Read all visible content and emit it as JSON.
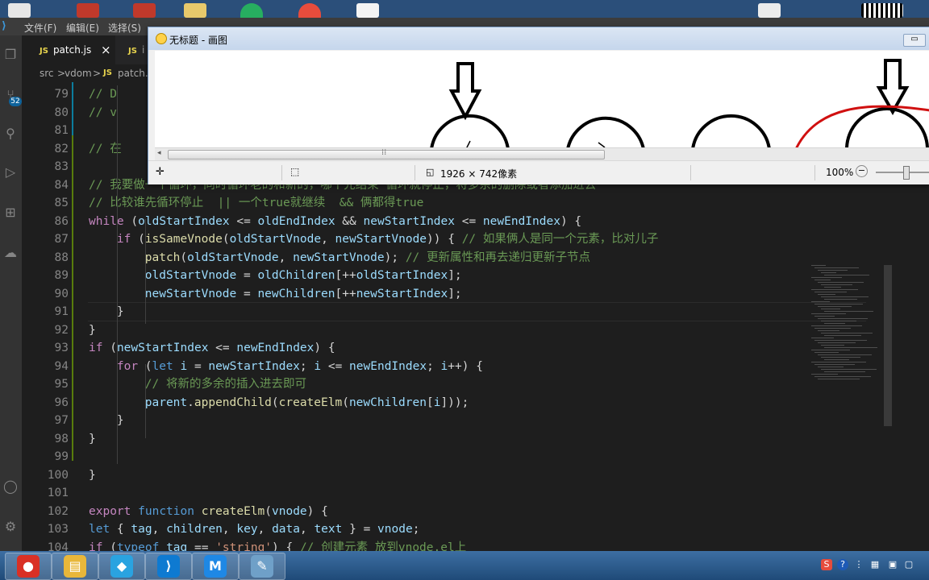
{
  "vscode": {
    "menu": [
      "文件(F)",
      "编辑(E)",
      "选择(S)"
    ],
    "badge": "52",
    "tabs": [
      {
        "icon": "JS",
        "label": "patch.js",
        "close": "×"
      },
      {
        "icon": "JS",
        "label": "i"
      }
    ],
    "breadcrumb": [
      "src",
      "vdom",
      "patch.js"
    ],
    "breadcrumb_sep": ">",
    "breadcrumb_icon": "JS"
  },
  "paint": {
    "title": "无标题 - 画图",
    "minimize": "▭",
    "size": "1926 × 742像素",
    "zoom": "100%"
  },
  "code": [
    {
      "n": "79",
      "t": [
        [
          "cm",
          "// D"
        ]
      ],
      "i": 1
    },
    {
      "n": "80",
      "t": [
        [
          "cm",
          "// v"
        ]
      ],
      "i": 1
    },
    {
      "n": "81",
      "t": [],
      "i": 0
    },
    {
      "n": "82",
      "t": [
        [
          "cm",
          "// 在"
        ]
      ],
      "i": 1
    },
    {
      "n": "83",
      "t": [],
      "i": 0
    },
    {
      "n": "84",
      "t": [
        [
          "cm",
          "// 我要做一个循环，同时循环老的和新的，哪个先结束 循环就停止，将多余的删除或者添加进去"
        ]
      ],
      "i": 1
    },
    {
      "n": "85",
      "t": [
        [
          "cm",
          "// 比较谁先循环停止  || 一个true就继续  && 俩都得true"
        ]
      ],
      "i": 1
    },
    {
      "n": "86",
      "t": [
        [
          "ctl",
          "while"
        ],
        [
          "pn",
          " ("
        ],
        [
          "vr",
          "oldStartIndex"
        ],
        [
          "pn",
          " <= "
        ],
        [
          "vr",
          "oldEndIndex"
        ],
        [
          "pn",
          " && "
        ],
        [
          "vr",
          "newStartIndex"
        ],
        [
          "pn",
          " <= "
        ],
        [
          "vr",
          "newEndIndex"
        ],
        [
          "pn",
          ") {"
        ]
      ],
      "i": 1
    },
    {
      "n": "87",
      "t": [
        [
          "ctl",
          "if"
        ],
        [
          "pn",
          " ("
        ],
        [
          "fn",
          "isSameVnode"
        ],
        [
          "pn",
          "("
        ],
        [
          "vr",
          "oldStartVnode"
        ],
        [
          "pn",
          ", "
        ],
        [
          "vr",
          "newStartVnode"
        ],
        [
          "pn",
          ")) { "
        ],
        [
          "cm",
          "// 如果俩人是同一个元素，比对儿子"
        ]
      ],
      "i": 2
    },
    {
      "n": "88",
      "t": [
        [
          "fn",
          "patch"
        ],
        [
          "pn",
          "("
        ],
        [
          "vr",
          "oldStartVnode"
        ],
        [
          "pn",
          ", "
        ],
        [
          "vr",
          "newStartVnode"
        ],
        [
          "pn",
          "); "
        ],
        [
          "cm",
          "// 更新属性和再去递归更新子节点"
        ]
      ],
      "i": 3
    },
    {
      "n": "89",
      "t": [
        [
          "vr",
          "oldStartVnode"
        ],
        [
          "pn",
          " = "
        ],
        [
          "vr",
          "oldChildren"
        ],
        [
          "pn",
          "[++"
        ],
        [
          "vr",
          "oldStartIndex"
        ],
        [
          "pn",
          "];"
        ]
      ],
      "i": 3
    },
    {
      "n": "90",
      "t": [
        [
          "vr",
          "newStartVnode"
        ],
        [
          "pn",
          " = "
        ],
        [
          "vr",
          "newChildren"
        ],
        [
          "pn",
          "[++"
        ],
        [
          "vr",
          "newStartIndex"
        ],
        [
          "pn",
          "];"
        ]
      ],
      "i": 3
    },
    {
      "n": "91",
      "t": [
        [
          "pn",
          "}"
        ]
      ],
      "i": 2
    },
    {
      "n": "92",
      "t": [
        [
          "pn",
          "}"
        ]
      ],
      "i": 1
    },
    {
      "n": "93",
      "t": [
        [
          "ctl",
          "if"
        ],
        [
          "pn",
          " ("
        ],
        [
          "vr",
          "newStartIndex"
        ],
        [
          "pn",
          " <= "
        ],
        [
          "vr",
          "newEndIndex"
        ],
        [
          "pn",
          ") {"
        ]
      ],
      "i": 1
    },
    {
      "n": "94",
      "t": [
        [
          "ctl",
          "for"
        ],
        [
          "pn",
          " ("
        ],
        [
          "kw",
          "let"
        ],
        [
          "pn",
          " "
        ],
        [
          "vr",
          "i"
        ],
        [
          "pn",
          " = "
        ],
        [
          "vr",
          "newStartIndex"
        ],
        [
          "pn",
          "; "
        ],
        [
          "vr",
          "i"
        ],
        [
          "pn",
          " <= "
        ],
        [
          "vr",
          "newEndIndex"
        ],
        [
          "pn",
          "; "
        ],
        [
          "vr",
          "i"
        ],
        [
          "pn",
          "++) {"
        ]
      ],
      "i": 2
    },
    {
      "n": "95",
      "t": [
        [
          "cm",
          "// 将新的多余的插入进去即可"
        ]
      ],
      "i": 3
    },
    {
      "n": "96",
      "t": [
        [
          "vr",
          "parent"
        ],
        [
          "pn",
          "."
        ],
        [
          "fn",
          "appendChild"
        ],
        [
          "pn",
          "("
        ],
        [
          "fn",
          "createElm"
        ],
        [
          "pn",
          "("
        ],
        [
          "vr",
          "newChildren"
        ],
        [
          "pn",
          "["
        ],
        [
          "vr",
          "i"
        ],
        [
          "pn",
          "]));"
        ]
      ],
      "i": 3
    },
    {
      "n": "97",
      "t": [
        [
          "pn",
          "}"
        ]
      ],
      "i": 2
    },
    {
      "n": "98",
      "t": [
        [
          "pn",
          "}"
        ]
      ],
      "i": 1
    },
    {
      "n": "99",
      "t": [],
      "i": 0
    },
    {
      "n": "100",
      "t": [
        [
          "pn",
          "}"
        ]
      ],
      "i": 0
    },
    {
      "n": "101",
      "t": [],
      "i": 0
    },
    {
      "n": "102",
      "t": [
        [
          "ctl",
          "export"
        ],
        [
          "pn",
          " "
        ],
        [
          "kw",
          "function"
        ],
        [
          "pn",
          " "
        ],
        [
          "fn",
          "createElm"
        ],
        [
          "pn",
          "("
        ],
        [
          "vr",
          "vnode"
        ],
        [
          "pn",
          ") {"
        ]
      ],
      "i": 0
    },
    {
      "n": "103",
      "t": [
        [
          "kw",
          "let"
        ],
        [
          "pn",
          " { "
        ],
        [
          "vr",
          "tag"
        ],
        [
          "pn",
          ", "
        ],
        [
          "vr",
          "children"
        ],
        [
          "pn",
          ", "
        ],
        [
          "vr",
          "key"
        ],
        [
          "pn",
          ", "
        ],
        [
          "vr",
          "data"
        ],
        [
          "pn",
          ", "
        ],
        [
          "vr",
          "text"
        ],
        [
          "pn",
          " } = "
        ],
        [
          "vr",
          "vnode"
        ],
        [
          "pn",
          ";"
        ]
      ],
      "i": 1
    },
    {
      "n": "104",
      "t": [
        [
          "ctl",
          "if"
        ],
        [
          "pn",
          " ("
        ],
        [
          "kw",
          "typeof"
        ],
        [
          "pn",
          " "
        ],
        [
          "vr",
          "tag"
        ],
        [
          "pn",
          " == "
        ],
        [
          "st",
          "'string'"
        ],
        [
          "pn",
          ") { "
        ],
        [
          "cm",
          "// 创建元素 放到vnode.el上"
        ]
      ],
      "i": 1
    }
  ],
  "taskbar": {
    "apps": [
      {
        "name": "chrome",
        "glyph": "●",
        "color": "#d93025"
      },
      {
        "name": "explorer",
        "glyph": "▤",
        "color": "#e8b73a"
      },
      {
        "name": "app-blue",
        "glyph": "◆",
        "color": "#2aa3e0"
      },
      {
        "name": "vscode",
        "glyph": "⟩",
        "color": "#0e7ad1"
      },
      {
        "name": "app-m",
        "glyph": "M",
        "color": "#1e88e5"
      },
      {
        "name": "paint",
        "glyph": "✎",
        "color": "#6fa0c8"
      }
    ]
  }
}
